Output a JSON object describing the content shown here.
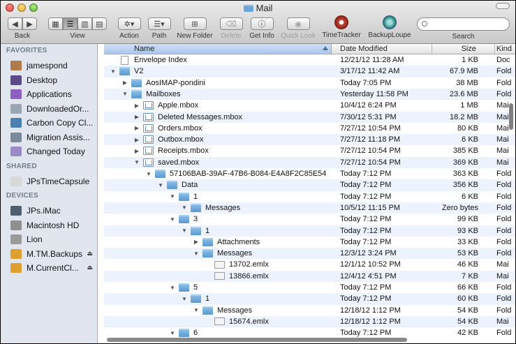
{
  "window": {
    "title": "Mail"
  },
  "toolbar": {
    "back": "Back",
    "view": "View",
    "action": "Action",
    "path": "Path",
    "new_folder": "New Folder",
    "delete": "Delete",
    "get_info": "Get Info",
    "quick_look": "Quick Look",
    "timetracker": "TimeTracker",
    "backuploupe": "BackupLoupe",
    "search_label": "Search",
    "search_placeholder": ""
  },
  "sidebar": {
    "favorites_header": "FAVORITES",
    "favorites": [
      {
        "label": "jamespond",
        "icon": "home-icon",
        "color": "#b07a4a"
      },
      {
        "label": "Desktop",
        "icon": "desktop-icon",
        "color": "#5a4a8a"
      },
      {
        "label": "Applications",
        "icon": "applications-icon",
        "color": "#8c5fc0"
      },
      {
        "label": "DownloadedOr...",
        "icon": "folder-icon",
        "color": "#9aa6b6"
      },
      {
        "label": "Carbon Copy Cl...",
        "icon": "carbon-copy-icon",
        "color": "#4b7fb0"
      },
      {
        "label": "Migration Assis...",
        "icon": "migration-icon",
        "color": "#7a8a9a"
      },
      {
        "label": "Changed Today",
        "icon": "smart-folder-icon",
        "color": "#9b8ac8"
      }
    ],
    "shared_header": "SHARED",
    "shared": [
      {
        "label": "JPsTimeCapsule",
        "icon": "time-capsule-icon",
        "color": "#d8d8d8"
      }
    ],
    "devices_header": "DEVICES",
    "devices": [
      {
        "label": "JPs.iMac",
        "icon": "imac-icon",
        "color": "#4f5f70"
      },
      {
        "label": "Macintosh HD",
        "icon": "hard-drive-icon",
        "color": "#8f8f8f"
      },
      {
        "label": "Lion",
        "icon": "disk-icon",
        "color": "#9a9a9a"
      },
      {
        "label": "M.TM.Backups",
        "icon": "backup-drive-icon",
        "color": "#e0a030",
        "eject": "⏏"
      },
      {
        "label": "M.CurrentCl...",
        "icon": "external-drive-icon",
        "color": "#e0a030",
        "eject": "⏏"
      }
    ]
  },
  "columns": {
    "name": "Name",
    "date": "Date Modified",
    "size": "Size",
    "kind": "Kind"
  },
  "rows": [
    {
      "indent": 0,
      "disclosure": "",
      "icon": "doc",
      "name": "Envelope Index",
      "date": "12/21/12 11:28 AM",
      "size": "1 KB",
      "kind": "Doc"
    },
    {
      "indent": 0,
      "disclosure": "open",
      "icon": "folder",
      "name": "V2",
      "date": "3/17/12 11:42 AM",
      "size": "67.9 MB",
      "kind": "Fold"
    },
    {
      "indent": 1,
      "disclosure": "closed",
      "icon": "folder",
      "name": "AosIMAP-pondini",
      "date": "Today 7:05 PM",
      "size": "38 MB",
      "kind": "Fold"
    },
    {
      "indent": 1,
      "disclosure": "open",
      "icon": "folder",
      "name": "Mailboxes",
      "date": "Yesterday 11:58 PM",
      "size": "23.6 MB",
      "kind": "Fold"
    },
    {
      "indent": 2,
      "disclosure": "closed",
      "icon": "mbox",
      "name": "Apple.mbox",
      "date": "10/4/12 6:24 PM",
      "size": "1 MB",
      "kind": "Mai"
    },
    {
      "indent": 2,
      "disclosure": "closed",
      "icon": "mbox",
      "name": "Deleted Messages.mbox",
      "date": "7/30/12 5:31 PM",
      "size": "18.2 MB",
      "kind": "Mai"
    },
    {
      "indent": 2,
      "disclosure": "closed",
      "icon": "mbox",
      "name": "Orders.mbox",
      "date": "7/27/12 10:54 PM",
      "size": "80 KB",
      "kind": "Mai"
    },
    {
      "indent": 2,
      "disclosure": "closed",
      "icon": "mbox",
      "name": "Outbox.mbox",
      "date": "7/27/12 11:18 PM",
      "size": "6 KB",
      "kind": "Mai"
    },
    {
      "indent": 2,
      "disclosure": "closed",
      "icon": "mbox",
      "name": "Receipts.mbox",
      "date": "7/27/12 10:54 PM",
      "size": "385 KB",
      "kind": "Mai"
    },
    {
      "indent": 2,
      "disclosure": "open",
      "icon": "mbox",
      "name": "saved.mbox",
      "date": "7/27/12 10:54 PM",
      "size": "369 KB",
      "kind": "Mai"
    },
    {
      "indent": 3,
      "disclosure": "open",
      "icon": "folder",
      "name": "57106BAB-39AF-47B6-B084-E4A8F2C85E54",
      "date": "Today 7:12 PM",
      "size": "363 KB",
      "kind": "Fold"
    },
    {
      "indent": 4,
      "disclosure": "open",
      "icon": "folder",
      "name": "Data",
      "date": "Today 7:12 PM",
      "size": "356 KB",
      "kind": "Fold"
    },
    {
      "indent": 5,
      "disclosure": "open",
      "icon": "folder",
      "name": "1",
      "date": "Today 7:12 PM",
      "size": "6 KB",
      "kind": "Fold"
    },
    {
      "indent": 6,
      "disclosure": "open",
      "icon": "folder",
      "name": "Messages",
      "date": "10/5/12 11:15 PM",
      "size": "Zero bytes",
      "kind": "Fold"
    },
    {
      "indent": 5,
      "disclosure": "open",
      "icon": "folder",
      "name": "3",
      "date": "Today 7:12 PM",
      "size": "99 KB",
      "kind": "Fold"
    },
    {
      "indent": 6,
      "disclosure": "open",
      "icon": "folder",
      "name": "1",
      "date": "Today 7:12 PM",
      "size": "93 KB",
      "kind": "Fold"
    },
    {
      "indent": 7,
      "disclosure": "closed",
      "icon": "folder",
      "name": "Attachments",
      "date": "Today 7:12 PM",
      "size": "33 KB",
      "kind": "Fold"
    },
    {
      "indent": 7,
      "disclosure": "open",
      "icon": "folder",
      "name": "Messages",
      "date": "12/3/12 3:24 PM",
      "size": "53 KB",
      "kind": "Fold"
    },
    {
      "indent": 8,
      "disclosure": "",
      "icon": "eml",
      "name": "13702.emlx",
      "date": "12/1/12 10:52 PM",
      "size": "46 KB",
      "kind": "Mai"
    },
    {
      "indent": 8,
      "disclosure": "",
      "icon": "eml",
      "name": "13866.emlx",
      "date": "12/4/12 4:51 PM",
      "size": "7 KB",
      "kind": "Mai"
    },
    {
      "indent": 5,
      "disclosure": "open",
      "icon": "folder",
      "name": "5",
      "date": "Today 7:12 PM",
      "size": "66 KB",
      "kind": "Fold"
    },
    {
      "indent": 6,
      "disclosure": "open",
      "icon": "folder",
      "name": "1",
      "date": "Today 7:12 PM",
      "size": "60 KB",
      "kind": "Fold"
    },
    {
      "indent": 7,
      "disclosure": "open",
      "icon": "folder",
      "name": "Messages",
      "date": "12/18/12 1:12 PM",
      "size": "54 KB",
      "kind": "Fold"
    },
    {
      "indent": 8,
      "disclosure": "",
      "icon": "eml",
      "name": "15674.emlx",
      "date": "12/18/12 1:12 PM",
      "size": "54 KB",
      "kind": "Mai"
    },
    {
      "indent": 5,
      "disclosure": "open",
      "icon": "folder",
      "name": "6",
      "date": "Today 7:12 PM",
      "size": "42 KB",
      "kind": "Fold"
    }
  ]
}
